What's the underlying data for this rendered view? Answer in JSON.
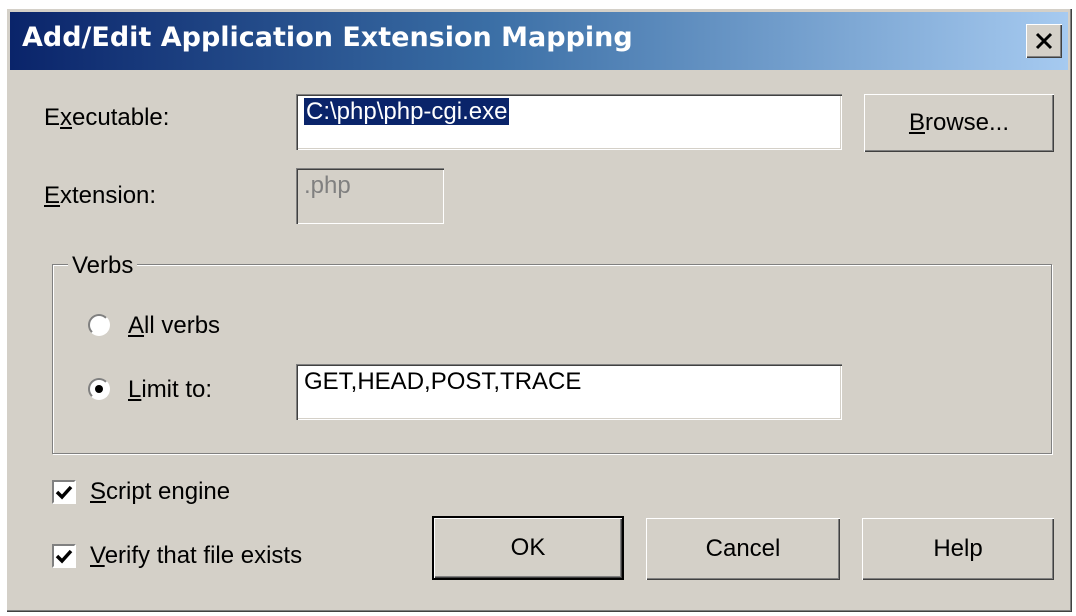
{
  "window": {
    "title": "Add/Edit Application Extension Mapping",
    "close_icon": "close-icon"
  },
  "executable": {
    "label_prefix": "E",
    "label_underlined": "x",
    "label_suffix": "ecutable:",
    "value": "C:\\php\\php-cgi.exe",
    "browse_prefix": "",
    "browse_underlined": "B",
    "browse_suffix": "rowse..."
  },
  "extension": {
    "label_underlined": "E",
    "label_suffix": "xtension:",
    "value": ".php"
  },
  "verbs": {
    "group_label": "Verbs",
    "all_verbs_underlined": "A",
    "all_verbs_suffix": "ll verbs",
    "limit_to_underlined": "L",
    "limit_to_suffix": "imit to:",
    "limit_value": "GET,HEAD,POST,TRACE",
    "selected": "limit"
  },
  "options": {
    "script_engine_underlined": "S",
    "script_engine_suffix": "cript engine",
    "script_engine_checked": true,
    "verify_underlined": "V",
    "verify_suffix": "erify that file exists",
    "verify_checked": true
  },
  "buttons": {
    "ok": "OK",
    "cancel": "Cancel",
    "help": "Help"
  }
}
